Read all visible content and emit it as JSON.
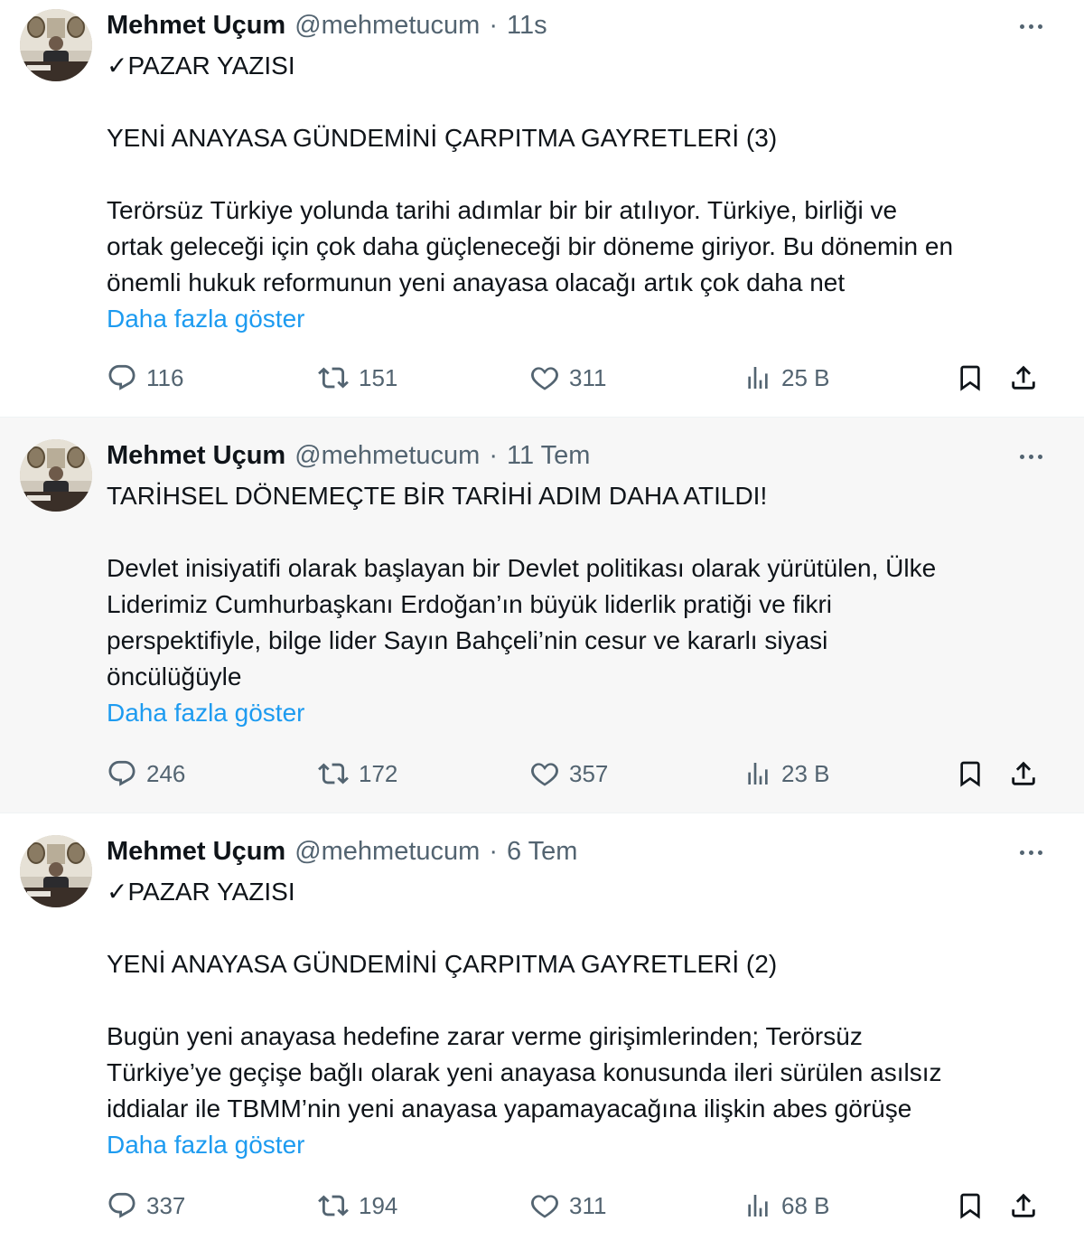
{
  "tweets": [
    {
      "author": {
        "name": "Mehmet Uçum",
        "handle": "@mehmetucum"
      },
      "separator": "·",
      "time": "11s",
      "lines": [
        "✓PAZAR YAZISI",
        "",
        "YENİ ANAYASA GÜNDEMİNİ ÇARPITMA GAYRETLERİ (3)",
        "",
        "Terörsüz Türkiye yolunda tarihi adımlar bir bir atılıyor. Türkiye, birliği ve",
        "ortak geleceği için çok daha güçleneceği bir döneme giriyor. Bu dönemin en",
        "önemli hukuk reformunun yeni anayasa olacağı artık çok daha net"
      ],
      "show_more": "Daha fazla göster",
      "stats": {
        "replies": "116",
        "reposts": "151",
        "likes": "311",
        "views": "25 B"
      }
    },
    {
      "author": {
        "name": "Mehmet Uçum",
        "handle": "@mehmetucum"
      },
      "separator": "·",
      "time": "11 Tem",
      "lines": [
        "TARİHSEL DÖNEMEÇTE BİR TARİHİ ADIM DAHA ATILDI!",
        "",
        "Devlet inisiyatifi olarak başlayan bir Devlet politikası olarak yürütülen, Ülke",
        "Liderimiz Cumhurbaşkanı Erdoğan’ın büyük liderlik pratiği ve fikri",
        "perspektifiyle, bilge lider Sayın Bahçeli’nin cesur ve kararlı siyasi",
        "öncülüğüyle"
      ],
      "show_more": "Daha fazla göster",
      "stats": {
        "replies": "246",
        "reposts": "172",
        "likes": "357",
        "views": "23 B"
      }
    },
    {
      "author": {
        "name": "Mehmet Uçum",
        "handle": "@mehmetucum"
      },
      "separator": "·",
      "time": "6 Tem",
      "lines": [
        "✓PAZAR YAZISI",
        "",
        "YENİ ANAYASA GÜNDEMİNİ ÇARPITMA GAYRETLERİ (2)",
        "",
        "Bugün yeni anayasa hedefine zarar verme girişimlerinden; Terörsüz",
        "Türkiye’ye geçişe bağlı olarak yeni anayasa konusunda ileri sürülen asılsız",
        "iddialar ile TBMM’nin yeni anayasa yapamayacağına ilişkin abes görüşe"
      ],
      "show_more": "Daha fazla göster",
      "stats": {
        "replies": "337",
        "reposts": "194",
        "likes": "311",
        "views": "68 B"
      }
    }
  ],
  "icons": {
    "reply": "reply-icon",
    "repost": "repost-icon",
    "like": "heart-icon",
    "views": "views-icon",
    "bookmark": "bookmark-icon",
    "share": "share-icon",
    "more": "more-icon"
  },
  "colors": {
    "link": "#1d9bf0",
    "secondary": "#536471",
    "text": "#0f1419",
    "highlight_bg": "#f7f7f7"
  }
}
